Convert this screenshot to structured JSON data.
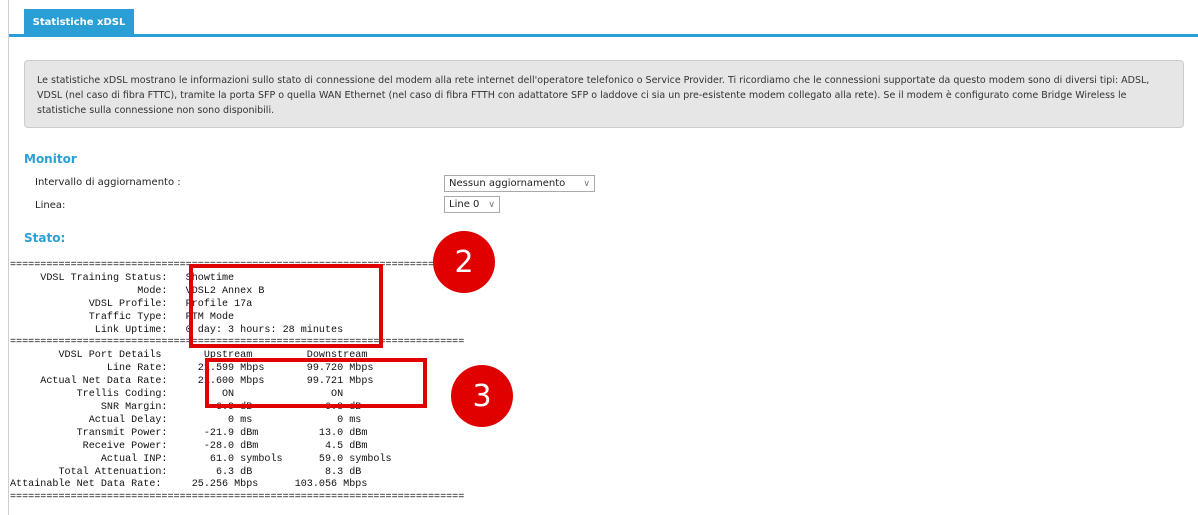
{
  "tab": {
    "label": "Statistiche xDSL"
  },
  "info": {
    "text": "Le statistiche xDSL mostrano le informazioni sullo stato di connessione del modem alla rete internet dell'operatore telefonico o Service Provider. Ti ricordiamo che le connessioni supportate da questo modem sono di diversi tipi: ADSL, VDSL (nel caso di fibra FTTC), tramite la porta SFP o quella WAN Ethernet (nel caso di fibra FTTH con adattatore SFP o laddove ci sia un pre-esistente modem collegato alla rete). Se il modem è configurato come Bridge Wireless le statistiche sulla connessione non sono disponibili."
  },
  "monitor": {
    "heading": "Monitor",
    "refresh_label": "Intervallo di aggiornamento :",
    "refresh_value": "Nessun aggiornamento",
    "line_label": "Linea:",
    "line_value": "Line 0"
  },
  "stato": {
    "heading": "Stato:",
    "rows": [
      "===========================================================================",
      "     VDSL Training Status:   Showtime",
      "                     Mode:   VDSL2 Annex B",
      "             VDSL Profile:   Profile 17a",
      "             Traffic Type:   PTM Mode",
      "              Link Uptime:   0 day: 3 hours: 28 minutes",
      "===========================================================================",
      "        VDSL Port Details       Upstream         Downstream",
      "                Line Rate:     21.599 Mbps       99.720 Mbps",
      "     Actual Net Data Rate:     21.600 Mbps       99.721 Mbps",
      "           Trellis Coding:         ON                ON",
      "               SNR Margin:        6.9 dB            6.8 dB",
      "             Actual Delay:          0 ms              0 ms",
      "           Transmit Power:      -21.9 dBm          13.0 dBm",
      "            Receive Power:      -28.0 dBm           4.5 dBm",
      "               Actual INP:       61.0 symbols      59.0 symbols",
      "        Total Attenuation:        6.3 dB            8.3 dB",
      "Attainable Net Data Rate:     25.256 Mbps      103.056 Mbps",
      "==========================================================================="
    ]
  },
  "annotations": {
    "badge_2": "2",
    "badge_3": "3",
    "color": "#e00000"
  }
}
